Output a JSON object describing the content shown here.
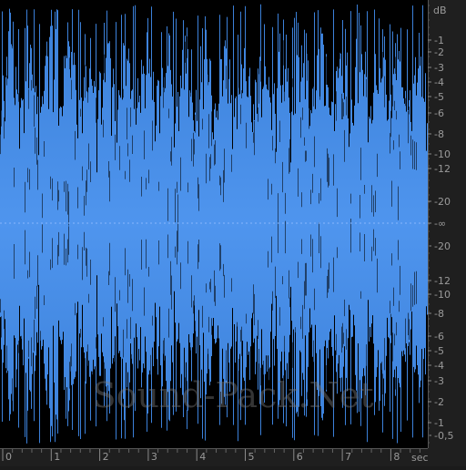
{
  "window": {
    "background": "#1f1f1f",
    "wave_background": "#000000"
  },
  "waveform": {
    "color": "#4a8fe8",
    "highlight_color": "#7fb6ff",
    "duration_sec": 8.8,
    "peak_db": 0,
    "center_level": "-∞"
  },
  "db_ruler": {
    "unit_label": "dB",
    "labels": [
      "-1",
      "-2",
      "-3",
      "-4",
      "-5",
      "-6",
      "-8",
      "-10",
      "-12",
      "-20",
      "-∞",
      "-20",
      "-12",
      "-10",
      "-8",
      "-6",
      "-5",
      "-4",
      "-3",
      "-2",
      "-1",
      "-0,5"
    ],
    "text_color": "#9a9a9a"
  },
  "time_ruler": {
    "unit_label": "sec",
    "labels": [
      "0",
      "1",
      "2",
      "3",
      "4",
      "5",
      "6",
      "7",
      "8"
    ],
    "text_color": "#9a9a9a"
  },
  "watermark": {
    "text": "Sound-Pack.Net"
  }
}
